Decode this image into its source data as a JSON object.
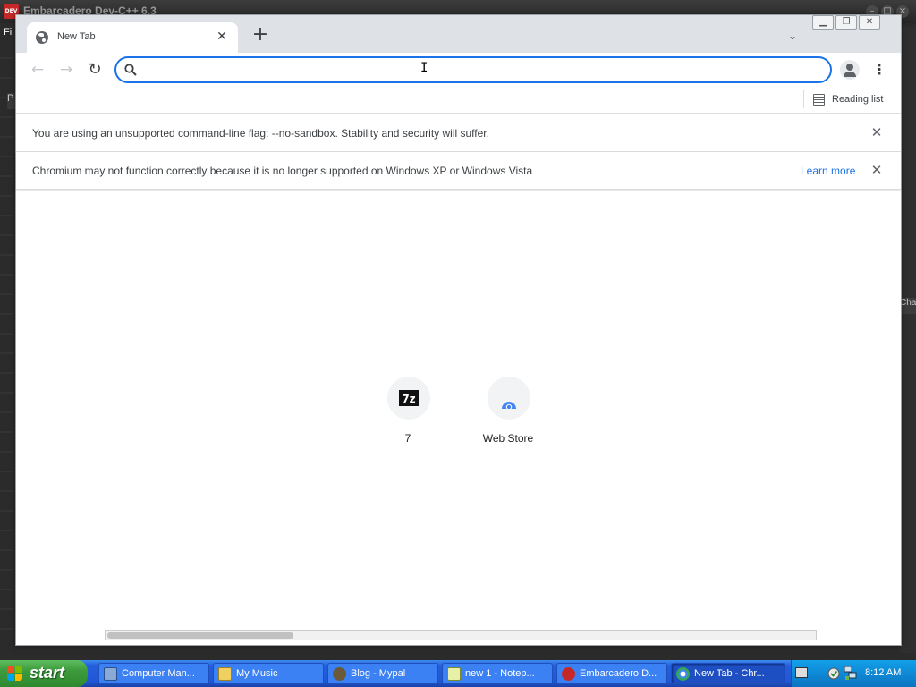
{
  "background_app": {
    "title": "Embarcadero Dev-C++ 6.3",
    "menu_stub": "Fi",
    "panel_stub": "P",
    "right_stub": "Cha"
  },
  "browser": {
    "tab": {
      "title": "New Tab"
    },
    "omnibox": {
      "value": "",
      "placeholder": ""
    },
    "reading_list_label": "Reading list",
    "infobars": [
      {
        "text": "You are using an unsupported command-line flag: --no-sandbox. Stability and security will suffer.",
        "link": ""
      },
      {
        "text": "Chromium may not function correctly because it is no longer supported on Windows XP or Windows Vista",
        "link": "Learn more"
      }
    ],
    "shortcuts": [
      {
        "label": "7",
        "icon": "7z-icon",
        "glyph": "7z"
      },
      {
        "label": "Web Store",
        "icon": "web-store-icon"
      }
    ]
  },
  "taskbar": {
    "start_label": "start",
    "items": [
      {
        "label": "Computer Man...",
        "icon": "computer-management-icon",
        "active": false
      },
      {
        "label": "My Music",
        "icon": "folder-music-icon",
        "active": false
      },
      {
        "label": "Blog - Mypal",
        "icon": "mypal-browser-icon",
        "active": false
      },
      {
        "label": "new 1 - Notep...",
        "icon": "notepad-icon",
        "active": false
      },
      {
        "label": "Embarcadero D...",
        "icon": "devcpp-icon",
        "active": false
      },
      {
        "label": "New Tab - Chr...",
        "icon": "chromium-icon",
        "active": true
      }
    ],
    "clock": "8:12 AM"
  },
  "colors": {
    "accent": "#1a73e8",
    "taskbar_blue": "#245edb",
    "start_green": "#3c9a3c",
    "tray_blue": "#0f89d6"
  }
}
